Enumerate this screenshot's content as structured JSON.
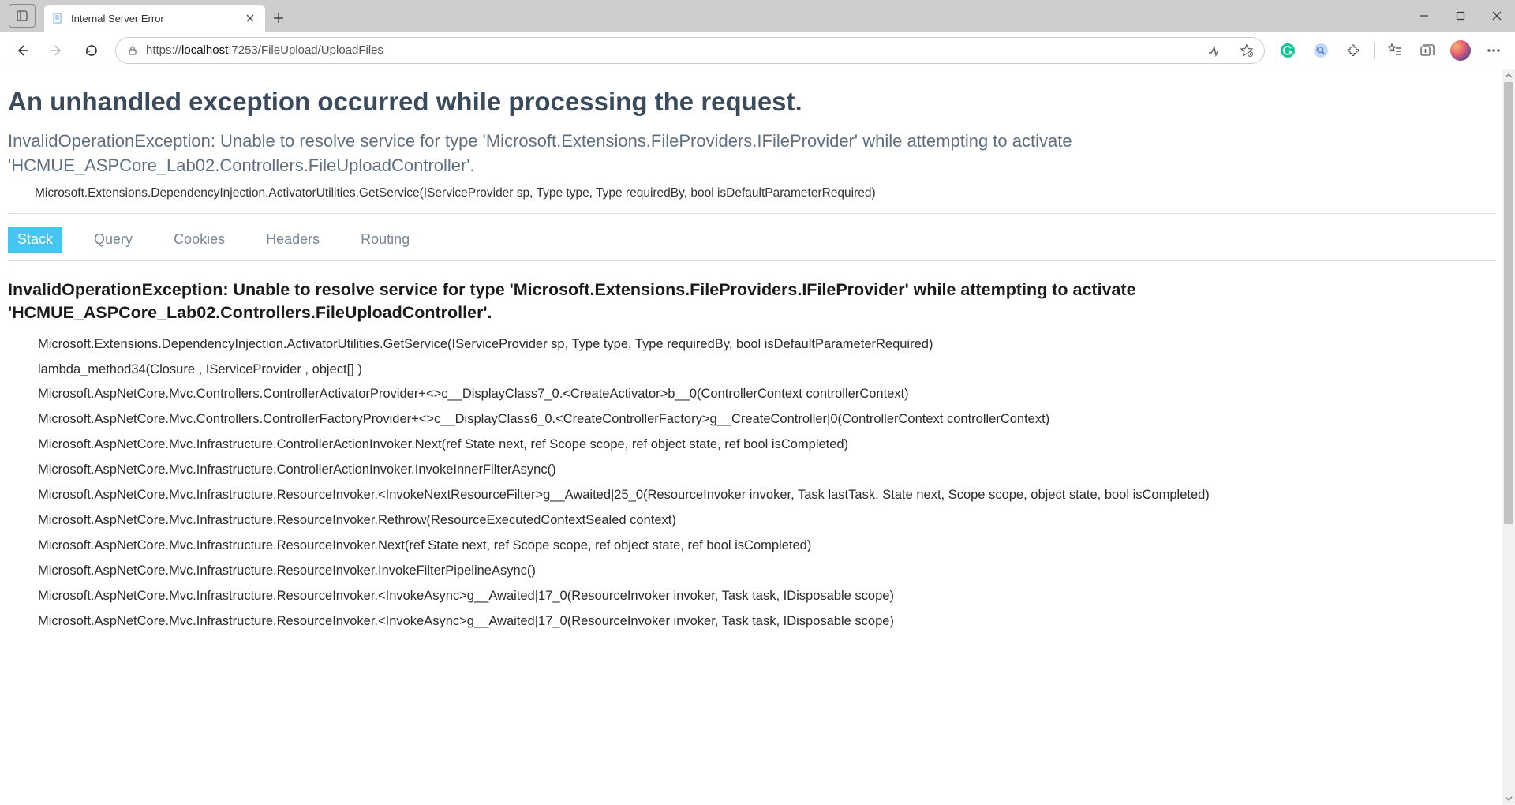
{
  "browser": {
    "tab_title": "Internal Server Error",
    "url_prefix": "https://",
    "url_host": "localhost",
    "url_port_path": ":7253/FileUpload/UploadFiles"
  },
  "page": {
    "heading": "An unhandled exception occurred while processing the request.",
    "exception_summary": "InvalidOperationException: Unable to resolve service for type 'Microsoft.Extensions.FileProviders.IFileProvider' while attempting to activate 'HCMUE_ASPCore_Lab02.Controllers.FileUploadController'.",
    "exception_source": "Microsoft.Extensions.DependencyInjection.ActivatorUtilities.GetService(IServiceProvider sp, Type type, Type requiredBy, bool isDefaultParameterRequired)",
    "tabs": {
      "stack": "Stack",
      "query": "Query",
      "cookies": "Cookies",
      "headers": "Headers",
      "routing": "Routing"
    },
    "detail_heading": "InvalidOperationException: Unable to resolve service for type 'Microsoft.Extensions.FileProviders.IFileProvider' while attempting to activate 'HCMUE_ASPCore_Lab02.Controllers.FileUploadController'.",
    "stack": [
      "Microsoft.Extensions.DependencyInjection.ActivatorUtilities.GetService(IServiceProvider sp, Type type, Type requiredBy, bool isDefaultParameterRequired)",
      "lambda_method34(Closure , IServiceProvider , object[] )",
      "Microsoft.AspNetCore.Mvc.Controllers.ControllerActivatorProvider+<>c__DisplayClass7_0.<CreateActivator>b__0(ControllerContext controllerContext)",
      "Microsoft.AspNetCore.Mvc.Controllers.ControllerFactoryProvider+<>c__DisplayClass6_0.<CreateControllerFactory>g__CreateController|0(ControllerContext controllerContext)",
      "Microsoft.AspNetCore.Mvc.Infrastructure.ControllerActionInvoker.Next(ref State next, ref Scope scope, ref object state, ref bool isCompleted)",
      "Microsoft.AspNetCore.Mvc.Infrastructure.ControllerActionInvoker.InvokeInnerFilterAsync()",
      "Microsoft.AspNetCore.Mvc.Infrastructure.ResourceInvoker.<InvokeNextResourceFilter>g__Awaited|25_0(ResourceInvoker invoker, Task lastTask, State next, Scope scope, object state, bool isCompleted)",
      "Microsoft.AspNetCore.Mvc.Infrastructure.ResourceInvoker.Rethrow(ResourceExecutedContextSealed context)",
      "Microsoft.AspNetCore.Mvc.Infrastructure.ResourceInvoker.Next(ref State next, ref Scope scope, ref object state, ref bool isCompleted)",
      "Microsoft.AspNetCore.Mvc.Infrastructure.ResourceInvoker.InvokeFilterPipelineAsync()",
      "Microsoft.AspNetCore.Mvc.Infrastructure.ResourceInvoker.<InvokeAsync>g__Awaited|17_0(ResourceInvoker invoker, Task task, IDisposable scope)",
      "Microsoft.AspNetCore.Mvc.Infrastructure.ResourceInvoker.<InvokeAsync>g__Awaited|17_0(ResourceInvoker invoker, Task task, IDisposable scope)"
    ]
  }
}
